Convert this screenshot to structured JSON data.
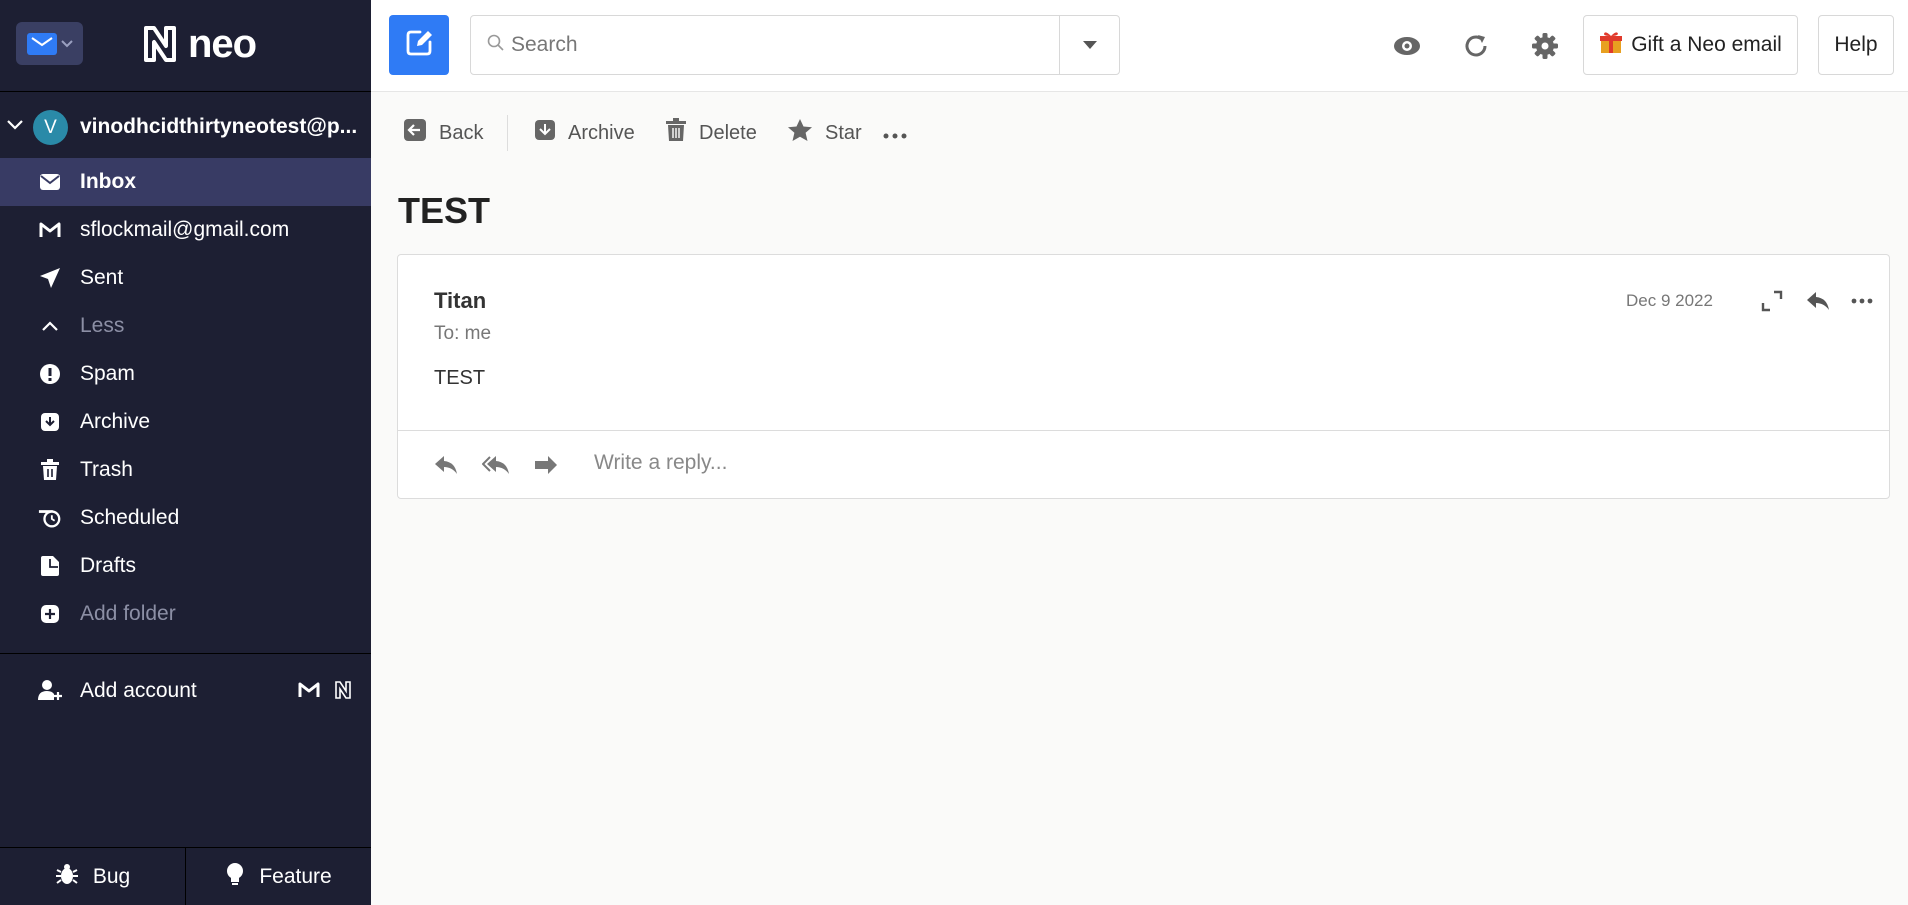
{
  "app": {
    "brand": "neo"
  },
  "sidebar": {
    "account_initial": "V",
    "account_email": "vinodhcidthirtyneotest@p...",
    "items": [
      {
        "label": "Inbox",
        "icon": "envelope-icon",
        "active": true
      },
      {
        "label": "sflockmail@gmail.com",
        "icon": "gmail-icon"
      },
      {
        "label": "Sent",
        "icon": "paper-plane-icon"
      },
      {
        "label": "Less",
        "icon": "chevron-up-icon"
      },
      {
        "label": "Spam",
        "icon": "exclamation-circle-icon"
      },
      {
        "label": "Archive",
        "icon": "archive-box-icon"
      },
      {
        "label": "Trash",
        "icon": "trash-icon"
      },
      {
        "label": "Scheduled",
        "icon": "scheduled-clock-icon"
      },
      {
        "label": "Drafts",
        "icon": "drafts-icon"
      },
      {
        "label": "Add folder",
        "icon": "plus-square-icon"
      }
    ],
    "add_account": "Add account",
    "bug": "Bug",
    "feature": "Feature"
  },
  "topbar": {
    "search_placeholder": "Search",
    "gift_label": "Gift a Neo email",
    "help_label": "Help"
  },
  "toolbar": {
    "back": "Back",
    "archive": "Archive",
    "delete": "Delete",
    "star": "Star"
  },
  "message": {
    "subject": "TEST",
    "sender": "Titan",
    "to": "To: me",
    "date": "Dec 9 2022",
    "body": "TEST",
    "reply_placeholder": "Write a reply..."
  },
  "colors": {
    "sidebar_bg": "#1d1f33",
    "sidebar_active": "#383b64",
    "accent": "#2f7bf5",
    "avatar": "#2a8aa8"
  }
}
